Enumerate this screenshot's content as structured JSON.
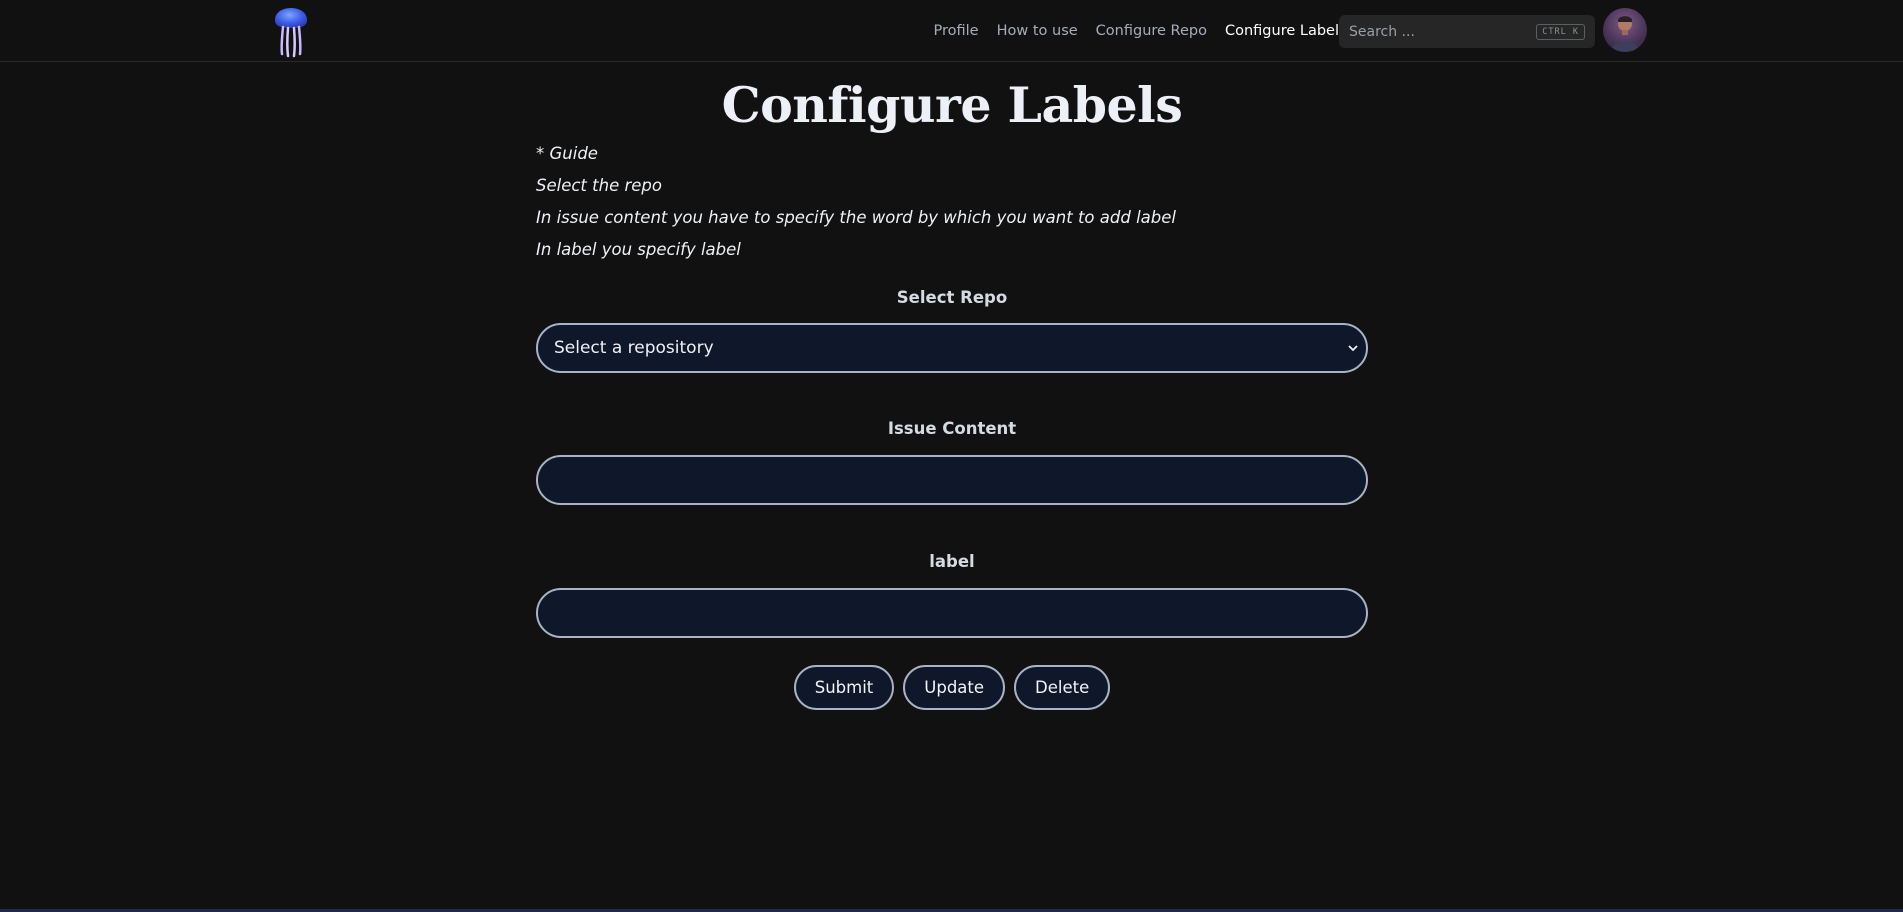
{
  "nav": {
    "links": [
      "Profile",
      "How to use",
      "Configure Repo",
      "Configure Label"
    ],
    "active_index": 3,
    "search": {
      "placeholder": "Search ...",
      "shortcut": "CTRL K"
    }
  },
  "main": {
    "title": "Configure Labels",
    "guide": [
      "* Guide",
      "Select the repo",
      "In issue content you have to specify the word by which you want to add label",
      "In label you specify label"
    ],
    "select_repo": {
      "label": "Select Repo",
      "value": "Select a repository"
    },
    "issue_content": {
      "label": "Issue Content",
      "value": ""
    },
    "label_field": {
      "label": "label",
      "value": ""
    },
    "buttons": {
      "submit": "Submit",
      "update": "Update",
      "delete": "Delete"
    }
  },
  "colors": {
    "background": "#111111",
    "field_background": "#0f172a",
    "field_border": "#a8b4c6",
    "nav_inactive": "#a7adb8",
    "nav_active": "#ffffff"
  }
}
